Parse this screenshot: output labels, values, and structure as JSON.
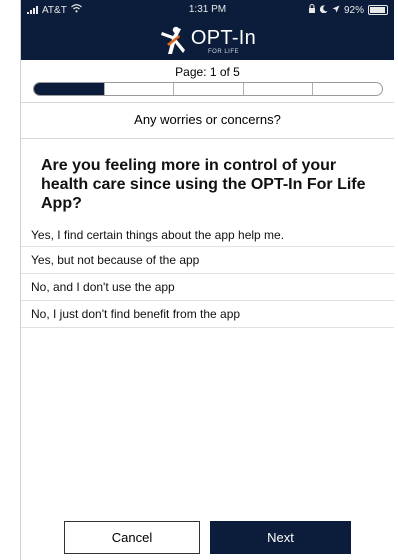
{
  "status_bar": {
    "carrier": "AT&T",
    "time": "1:31 PM",
    "battery": "92%"
  },
  "brand": {
    "name": "OPT-In",
    "subtitle": "FOR LIFE"
  },
  "progress": {
    "label": "Page: 1 of 5",
    "current": 1,
    "total": 5
  },
  "section": {
    "title": "Any worries or concerns?"
  },
  "question": {
    "text": "Are you feeling more in control of your health care since using the OPT-In For Life App?"
  },
  "options": [
    "Yes, I find certain things about the app help me.",
    "Yes, but not because of the app",
    "No, and I don't use the app",
    "No, I just don't find benefit from the app"
  ],
  "buttons": {
    "cancel": "Cancel",
    "next": "Next"
  },
  "colors": {
    "brand_navy": "#0b1d3a"
  }
}
